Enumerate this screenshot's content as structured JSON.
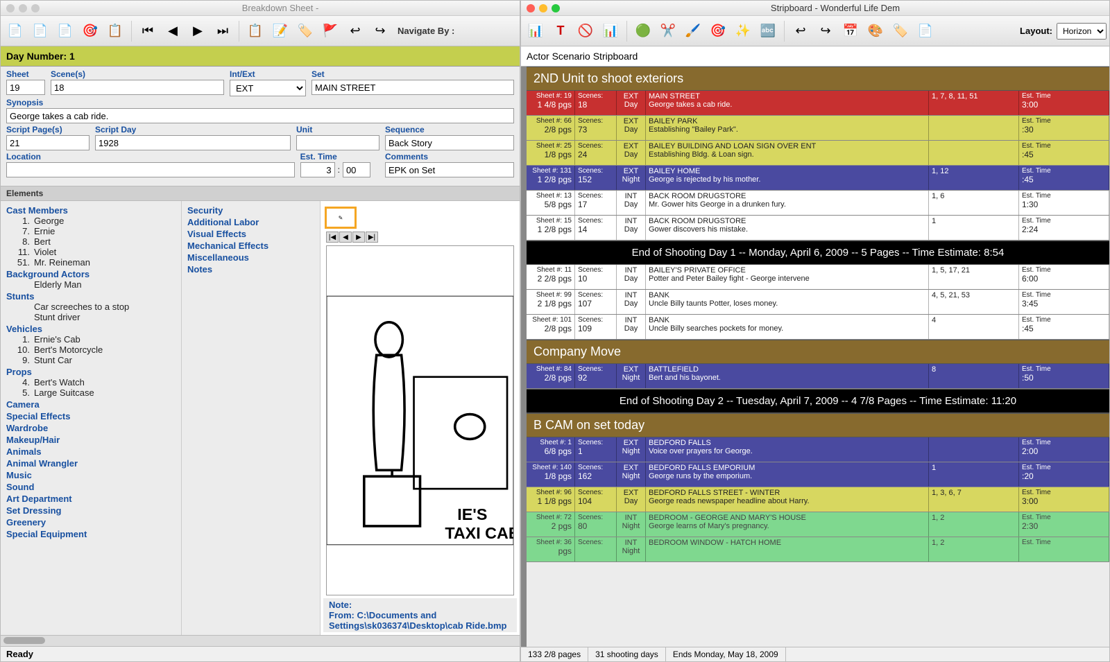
{
  "left": {
    "title": "Breakdown Sheet -",
    "day_banner": "Day Number: 1",
    "nav_label": "Navigate By :",
    "form": {
      "sheet_lbl": "Sheet",
      "sheet": "19",
      "scenes_lbl": "Scene(s)",
      "scenes": "18",
      "intext_lbl": "Int/Ext",
      "intext": "EXT",
      "set_lbl": "Set",
      "set": "MAIN STREET",
      "synopsis_lbl": "Synopsis",
      "synopsis": "George takes a cab ride.",
      "pages_lbl": "Script Page(s)",
      "pages": "21",
      "scriptday_lbl": "Script Day",
      "scriptday": "1928",
      "unit_lbl": "Unit",
      "unit": "",
      "sequence_lbl": "Sequence",
      "sequence": "Back Story",
      "location_lbl": "Location",
      "location": "",
      "esttime_lbl": "Est. Time",
      "est_h": "3",
      "est_m": "00",
      "comments_lbl": "Comments",
      "comments": "EPK on Set"
    },
    "elements_header": "Elements",
    "categories_left": [
      {
        "name": "Cast Members",
        "items": [
          {
            "n": "1.",
            "t": "George"
          },
          {
            "n": "7.",
            "t": "Ernie"
          },
          {
            "n": "8.",
            "t": "Bert"
          },
          {
            "n": "11.",
            "t": "Violet"
          },
          {
            "n": "51.",
            "t": "Mr. Reineman"
          }
        ]
      },
      {
        "name": "Background Actors",
        "items": [
          {
            "n": "",
            "t": "Elderly Man"
          }
        ]
      },
      {
        "name": "Stunts",
        "items": [
          {
            "n": "",
            "t": "Car screeches to a stop"
          },
          {
            "n": "",
            "t": "Stunt driver"
          }
        ]
      },
      {
        "name": "Vehicles",
        "items": [
          {
            "n": "1.",
            "t": "Ernie's Cab"
          },
          {
            "n": "10.",
            "t": "Bert's Motorcycle"
          },
          {
            "n": "9.",
            "t": "Stunt Car"
          }
        ]
      },
      {
        "name": "Props",
        "items": [
          {
            "n": "4.",
            "t": "Bert's Watch"
          },
          {
            "n": "5.",
            "t": "Large Suitcase"
          }
        ]
      },
      {
        "name": "Camera",
        "items": []
      },
      {
        "name": "Special Effects",
        "items": []
      },
      {
        "name": "Wardrobe",
        "items": []
      },
      {
        "name": "Makeup/Hair",
        "items": []
      },
      {
        "name": "Animals",
        "items": []
      },
      {
        "name": "Animal Wrangler",
        "items": []
      },
      {
        "name": "Music",
        "items": []
      },
      {
        "name": "Sound",
        "items": []
      },
      {
        "name": "Art Department",
        "items": []
      },
      {
        "name": "Set Dressing",
        "items": []
      },
      {
        "name": "Greenery",
        "items": []
      },
      {
        "name": "Special Equipment",
        "items": []
      }
    ],
    "categories_mid": [
      "Security",
      "Additional Labor",
      "Visual Effects",
      "Mechanical Effects",
      "Miscellaneous",
      "Notes"
    ],
    "note_lbl": "Note:",
    "from_lbl": "From:  C:\\Documents and Settings\\sk036374\\Desktop\\cab Ride.bmp",
    "status": "Ready"
  },
  "right": {
    "title": "Stripboard - Wonderful Life Dem",
    "layout_lbl": "Layout:",
    "layout_val": "Horizon",
    "sb_title": "Actor Scenario Stripboard",
    "banners": {
      "b1": "2ND Unit to shoot exteriors",
      "d1": "End of Shooting Day 1 -- Monday, April 6, 2009 -- 5 Pages -- Time Estimate: 8:54",
      "b2": "Company Move",
      "d2": "End of Shooting Day 2 -- Tuesday, April 7, 2009 -- 4 7/8 Pages -- Time Estimate: 11:20",
      "b3": "B CAM  on set today"
    },
    "labels": {
      "sheet": "Sheet #:",
      "scenes": "Scenes:",
      "pgs": "pgs",
      "est": "Est. Time"
    },
    "strips1": [
      {
        "cls": "strip-red",
        "sh": "19",
        "pg": "1 4/8",
        "sc": "18",
        "ie": "EXT",
        "dn": "Day",
        "set": "MAIN STREET",
        "syn": "George takes a cab ride.",
        "cast": "1, 7, 8, 11, 51",
        "tm": "3:00"
      },
      {
        "cls": "strip-yellow",
        "sh": "66",
        "pg": "2/8",
        "sc": "73",
        "ie": "EXT",
        "dn": "Day",
        "set": "BAILEY PARK",
        "syn": "Establishing \"Bailey Park\".",
        "cast": "",
        "tm": ":30"
      },
      {
        "cls": "strip-yellow",
        "sh": "25",
        "pg": "1/8",
        "sc": "24",
        "ie": "EXT",
        "dn": "Day",
        "set": "BAILEY BUILDING AND LOAN SIGN OVER ENT",
        "syn": "Establishing Bldg. & Loan sign.",
        "cast": "",
        "tm": ":45"
      },
      {
        "cls": "strip-blue",
        "sh": "131",
        "pg": "1 2/8",
        "sc": "152",
        "ie": "EXT",
        "dn": "Night",
        "set": "BAILEY HOME",
        "syn": "George is rejected by his mother.",
        "cast": "1, 12",
        "tm": ":45"
      },
      {
        "cls": "strip-white",
        "sh": "13",
        "pg": "5/8",
        "sc": "17",
        "ie": "INT",
        "dn": "Day",
        "set": "BACK ROOM DRUGSTORE",
        "syn": "Mr. Gower hits George in a drunken fury.",
        "cast": "1, 6",
        "tm": "1:30"
      },
      {
        "cls": "strip-white",
        "sh": "15",
        "pg": "1 2/8",
        "sc": "14",
        "ie": "INT",
        "dn": "Day",
        "set": "BACK ROOM DRUGSTORE",
        "syn": "Gower discovers his mistake.",
        "cast": "1",
        "tm": "2:24"
      }
    ],
    "strips2": [
      {
        "cls": "strip-white",
        "sh": "11",
        "pg": "2 2/8",
        "sc": "10",
        "ie": "INT",
        "dn": "Day",
        "set": "BAILEY'S PRIVATE OFFICE",
        "syn": "Potter and Peter Bailey fight - George intervene",
        "cast": "1, 5, 17, 21",
        "tm": "6:00"
      },
      {
        "cls": "strip-white",
        "sh": "99",
        "pg": "2 1/8",
        "sc": "107",
        "ie": "INT",
        "dn": "Day",
        "set": "BANK",
        "syn": "Uncle Billy taunts Potter, loses money.",
        "cast": "4, 5, 21, 53",
        "tm": "3:45"
      },
      {
        "cls": "strip-white",
        "sh": "101",
        "pg": "2/8",
        "sc": "109",
        "ie": "INT",
        "dn": "Day",
        "set": "BANK",
        "syn": "Uncle Billy searches pockets for money.",
        "cast": "4",
        "tm": ":45"
      }
    ],
    "strips3": [
      {
        "cls": "strip-blue",
        "sh": "84",
        "pg": "2/8",
        "sc": "92",
        "ie": "EXT",
        "dn": "Night",
        "set": "BATTLEFIELD",
        "syn": "Bert and his bayonet.",
        "cast": "8",
        "tm": ":50"
      }
    ],
    "strips4": [
      {
        "cls": "strip-blue",
        "sh": "1",
        "pg": "6/8",
        "sc": "1",
        "ie": "EXT",
        "dn": "Night",
        "set": "BEDFORD FALLS",
        "syn": "Voice over prayers for George.",
        "cast": "",
        "tm": "2:00"
      },
      {
        "cls": "strip-blue",
        "sh": "140",
        "pg": "1/8",
        "sc": "162",
        "ie": "EXT",
        "dn": "Night",
        "set": "BEDFORD FALLS EMPORIUM",
        "syn": "George runs by the emporium.",
        "cast": "1",
        "tm": ":20"
      },
      {
        "cls": "strip-yellow",
        "sh": "96",
        "pg": "1 1/8",
        "sc": "104",
        "ie": "EXT",
        "dn": "Day",
        "set": "BEDFORD FALLS STREET - WINTER",
        "syn": "George reads newspaper headline about Harry.",
        "cast": "1, 3, 6, 7",
        "tm": "3:00"
      },
      {
        "cls": "strip-green",
        "sh": "72",
        "pg": "2",
        "sc": "80",
        "ie": "INT",
        "dn": "Night",
        "set": "BEDROOM - GEORGE AND MARY'S HOUSE",
        "syn": "George learns of Mary's pregnancy.",
        "cast": "1, 2",
        "tm": "2:30"
      },
      {
        "cls": "strip-green",
        "sh": "36",
        "pg": "",
        "sc": "",
        "ie": "INT",
        "dn": "Night",
        "set": "BEDROOM WINDOW - HATCH HOME",
        "syn": "",
        "cast": "1, 2",
        "tm": ""
      }
    ],
    "status": {
      "pages": "133 2/8 pages",
      "days": "31 shooting days",
      "end": "Ends Monday, May 18, 2009"
    }
  }
}
